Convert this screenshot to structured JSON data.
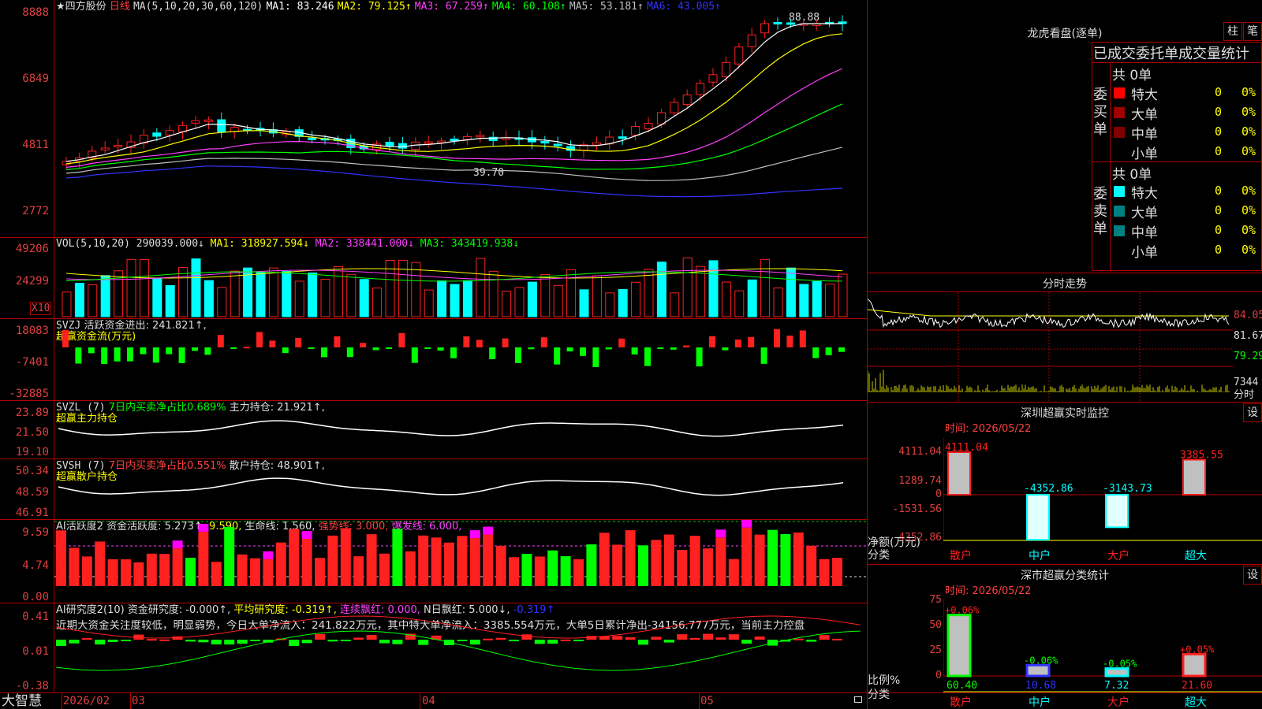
{
  "main": {
    "star": "★",
    "stock_name": "四方股份",
    "period": "日线",
    "ma_header": "MA(5,10,20,30,60,120)",
    "ma1": "MA1: 83.246",
    "ma2": "MA2: 79.125↑",
    "ma3": "MA3: 67.259↑",
    "ma4": "MA4: 60.108↑",
    "ma5": "MA5: 53.181↑",
    "ma6": "MA6: 43.005↑",
    "y_labels": [
      "8888",
      "6849",
      "4811",
      "2772"
    ],
    "high_mark": "88.88",
    "low_mark": "39.70",
    "colors": {
      "ma1": "#ffffff",
      "ma2": "#ffff00",
      "ma3": "#ff40ff",
      "ma4": "#00ff00",
      "ma5": "#c0c0c0",
      "ma6": "#3333ff"
    }
  },
  "vol": {
    "header": "VOL(5,10,20)",
    "value": "290039.000↓",
    "ma1": "MA1: 318927.594↓",
    "ma2": "MA2: 338441.000↓",
    "ma3": "MA3: 343419.938↓",
    "y_labels": [
      "49206",
      "24299"
    ],
    "unit": "X10"
  },
  "svzj": {
    "header": "SVZJ",
    "value": "活跃资金进出: 241.821↑,",
    "sub": "超赢资金流(万元)",
    "y_labels": [
      "18083",
      "-7401",
      "-32885"
    ]
  },
  "svzl": {
    "header": "SVZL (7)",
    "ratio": "7日内买卖净占比0.689%",
    "value": "主力持仓: 21.921↑,",
    "sub": "超赢主力持仓",
    "y_labels": [
      "23.89",
      "21.50",
      "19.10"
    ]
  },
  "svsh": {
    "header": "SVSH (7)",
    "ratio": "7日内买卖净占比0.551%",
    "value": "散户持仓: 48.901↑,",
    "sub": "超赢散户持仓",
    "y_labels": [
      "50.34",
      "48.59",
      "46.91"
    ]
  },
  "ai1": {
    "header": "AI活跃度2",
    "value": "资金活跃度: 5.273↑,",
    "v2": "9.590,",
    "life": "生命线: 1.560,",
    "strong": "强势线: 3.000,",
    "burst": "爆发线: 6.000,",
    "y_labels": [
      "9.59",
      "4.74",
      "0.00"
    ]
  },
  "ai2": {
    "header": "AI研究度2(10)",
    "value": "资金研究度: -0.000↑,",
    "avg": "平均研究度: -0.319↑,",
    "red": "连续飘红: 0.000,",
    "nred": "N日飘红: 5.000↓,",
    "tail": "-0.319↑",
    "note": "近期大资金关注度较低，明显弱势，今日大单净流入：241.822万元，其中特大单净流入：3385.554万元，大单5日累计净出-34156.777万元，当前主力控盘",
    "y_labels": [
      "0.41",
      "0.01",
      "-0.38"
    ]
  },
  "bottom": {
    "brand": "大智慧",
    "dates": [
      "2026/02",
      "03",
      "04",
      "05"
    ]
  },
  "dragon": {
    "title": "龙虎看盘(逐单)",
    "btn1": "柱",
    "btn2": "笔",
    "tabs": "已成交委托单成交量统计",
    "buy_label": "委买单",
    "sell_label": "委卖单",
    "buy_total": "共 0单",
    "sell_total": "共 0单",
    "buy_rows": [
      {
        "label": "特大",
        "count": "0",
        "pct": "0%",
        "color": "#ff0000"
      },
      {
        "label": "大单",
        "count": "0",
        "pct": "0%",
        "color": "#a00000"
      },
      {
        "label": "中单",
        "count": "0",
        "pct": "0%",
        "color": "#800000"
      },
      {
        "label": "小单",
        "count": "0",
        "pct": "0%",
        "color": ""
      }
    ],
    "sell_rows": [
      {
        "label": "特大",
        "count": "0",
        "pct": "0%",
        "color": "#00ffff"
      },
      {
        "label": "大单",
        "count": "0",
        "pct": "0%",
        "color": "#008080"
      },
      {
        "label": "中单",
        "count": "0",
        "pct": "0%",
        "color": "#008080"
      },
      {
        "label": "小单",
        "count": "0",
        "pct": "0%",
        "color": ""
      }
    ]
  },
  "intraday": {
    "title": "分时走势",
    "price_labels": [
      "84.05",
      "81.67",
      "79.29"
    ],
    "vol_label": "7344",
    "vol_unit": "分时"
  },
  "monitor": {
    "title": "深圳超赢实时监控",
    "btn": "设",
    "time": "时间: 2026/05/22",
    "y_labels": [
      "4111.04",
      "1289.74",
      "0",
      "-1531.56",
      "-4352.86"
    ],
    "unit_label": "净额(万元)",
    "cat_label": "分类",
    "categories": [
      "散户",
      "中户",
      "大户",
      "超大"
    ],
    "values": [
      4111.04,
      -4352.86,
      -3143.73,
      3385.55
    ],
    "value_labels": [
      "4111.04",
      "-4352.86",
      "-3143.73",
      "3385.55"
    ]
  },
  "stats": {
    "title": "深市超赢分类统计",
    "btn": "设",
    "time": "时间: 2026/05/22",
    "y_labels": [
      "75",
      "50",
      "25",
      "0"
    ],
    "ratio_label": "比例%",
    "cat_label": "分类",
    "categories": [
      "散户",
      "中户",
      "大户",
      "超大"
    ],
    "values": [
      60.4,
      10.68,
      7.32,
      21.6
    ],
    "value_labels": [
      "60.40",
      "10.68",
      "7.32",
      "21.60"
    ],
    "change_labels": [
      "+0.06%",
      "-0.06%",
      "-0.05%",
      "+0.05%"
    ]
  }
}
